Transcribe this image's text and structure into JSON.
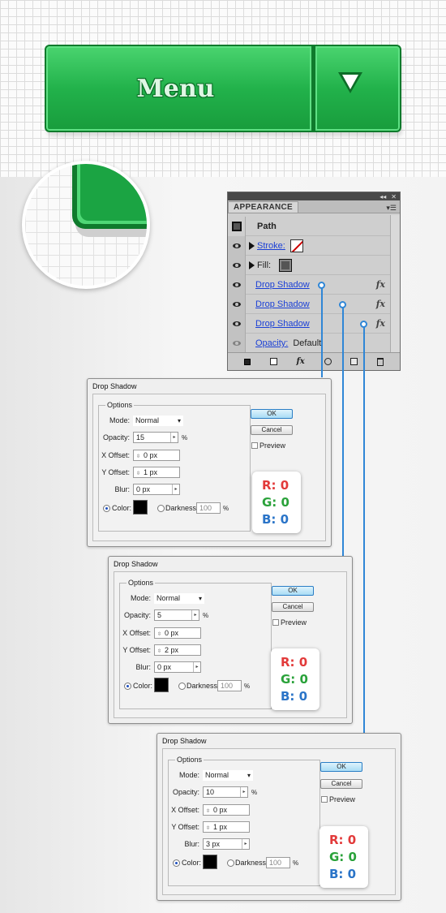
{
  "menu_button": {
    "label": "Menu"
  },
  "colors": {
    "green": "#22b24b",
    "dark_green": "#0f7a2c",
    "link_blue": "#1a3fd6",
    "wire_blue": "#2f86d6"
  },
  "appearance_panel": {
    "tab": "APPEARANCE",
    "path_label": "Path",
    "stroke_label": "Stroke:",
    "fill_label": "Fill:",
    "effects": [
      "Drop Shadow",
      "Drop Shadow",
      "Drop Shadow"
    ],
    "fx_label": "fx",
    "opacity_label": "Opacity:",
    "opacity_value": "Default",
    "footer_icons": [
      "new-art-icon",
      "clear-appearance-icon",
      "add-effect-icon",
      "duplicate-item-icon",
      "delete-icon"
    ]
  },
  "dialogs": [
    {
      "title": "Drop Shadow",
      "options": "Options",
      "mode_label": "Mode:",
      "mode": "Normal",
      "opacity_label": "Opacity:",
      "opacity": "15",
      "pct": "%",
      "x_label": "X Offset:",
      "x": "0 px",
      "y_label": "Y Offset:",
      "y": "1 px",
      "blur_label": "Blur:",
      "blur": "0 px",
      "color_label": "Color:",
      "darkness_label": "Darkness:",
      "darkness": "100",
      "ok": "OK",
      "cancel": "Cancel",
      "preview": "Preview",
      "r": "R: 0",
      "g": "G: 0",
      "b": "B: 0"
    },
    {
      "title": "Drop Shadow",
      "options": "Options",
      "mode_label": "Mode:",
      "mode": "Normal",
      "opacity_label": "Opacity:",
      "opacity": "5",
      "pct": "%",
      "x_label": "X Offset:",
      "x": "0 px",
      "y_label": "Y Offset:",
      "y": "2 px",
      "blur_label": "Blur:",
      "blur": "0 px",
      "color_label": "Color:",
      "darkness_label": "Darkness:",
      "darkness": "100",
      "ok": "OK",
      "cancel": "Cancel",
      "preview": "Preview",
      "r": "R: 0",
      "g": "G: 0",
      "b": "B: 0"
    },
    {
      "title": "Drop Shadow",
      "options": "Options",
      "mode_label": "Mode:",
      "mode": "Normal",
      "opacity_label": "Opacity:",
      "opacity": "10",
      "pct": "%",
      "x_label": "X Offset:",
      "x": "0 px",
      "y_label": "Y Offset:",
      "y": "1 px",
      "blur_label": "Blur:",
      "blur": "3 px",
      "color_label": "Color:",
      "darkness_label": "Darkness:",
      "darkness": "100",
      "ok": "OK",
      "cancel": "Cancel",
      "preview": "Preview",
      "r": "R: 0",
      "g": "G: 0",
      "b": "B: 0"
    }
  ]
}
